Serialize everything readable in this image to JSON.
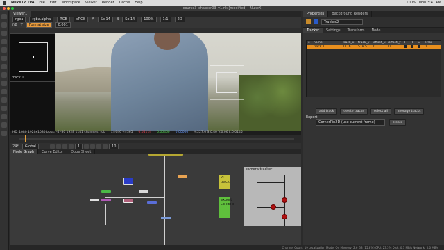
{
  "menubar": {
    "app_name": "Nuke12.1v4",
    "items": [
      "File",
      "Edit",
      "Workspace",
      "Viewer",
      "Render",
      "Cache",
      "Help"
    ],
    "right_items": [
      "100%",
      "Mon 3:41 PM"
    ]
  },
  "window": {
    "title": "course3_chapter03_v1.nk [modified] - NukeX"
  },
  "viewer": {
    "tab_label": "Viewer1",
    "channels": "rgba",
    "channel_alpha": "rgba.alpha",
    "colorspace": "RGB",
    "sRGB": "sRGB",
    "input_a": "A",
    "input_a_value": "Sol14",
    "input_b": "B",
    "input_b_value": "Sol14",
    "zoom": "100%",
    "proxy": "1:1",
    "mode": "2D",
    "gain_label": "f/8",
    "gamma_label": "Y",
    "format_box": "Format size",
    "format_value": "0.001",
    "minimap_label": "track 1",
    "info_left": "HD_1080 1920x1080  bbox: -4 -30 1928 1141 channels: rgb",
    "info_coords": "x=646 y=365",
    "info_r": "0.04114",
    "info_g": "0.05460",
    "info_b": "0.00000",
    "info_h": "H:227.0 S:0.40 V:0.06 L:0.0145"
  },
  "playback": {
    "fps_label": "24*",
    "global_label": "Global",
    "frame": "1",
    "end_frame": "10"
  },
  "node_graph": {
    "tabs": [
      "Node Graph",
      "Curve Editor",
      "Dope Sheet"
    ],
    "backdrops": [
      {
        "label": "2D track",
        "color": "#c7c23a"
      },
      {
        "label": "export camera",
        "color": "#5fbf3c"
      },
      {
        "label": "camera tracker",
        "color": "#b8b8b8"
      }
    ]
  },
  "properties": {
    "panel_tabs": [
      "Properties",
      "Background Renders"
    ],
    "node_name": "Tracker2",
    "node_tabs": [
      "Tracker",
      "Settings",
      "Transform",
      "Node"
    ],
    "columns": [
      "e",
      "name",
      "track_x",
      "track_y",
      "offset_x",
      "offset_y",
      "T",
      "R",
      "S",
      "error"
    ],
    "rows": [
      {
        "e": "1",
        "name": "track 1",
        "track_x": "1176",
        "track_y": "518.5",
        "offset_x": "0",
        "offset_y": "0",
        "T": "",
        "R": "",
        "S": "",
        "error": "0"
      }
    ],
    "buttons": [
      "add track",
      "delete tracks",
      "select all",
      "average tracks"
    ],
    "export_label": "Export",
    "export_option": "CornerPin2D (use current frame)",
    "create_label": "create"
  },
  "status": {
    "text": "Channel Count: 19  Localization Mode: On  Memory: 2.6 GB (15.8%)  CPU: 23.5%  Disk: 0.1 MB/s  Network: 0.0 MB/s"
  }
}
